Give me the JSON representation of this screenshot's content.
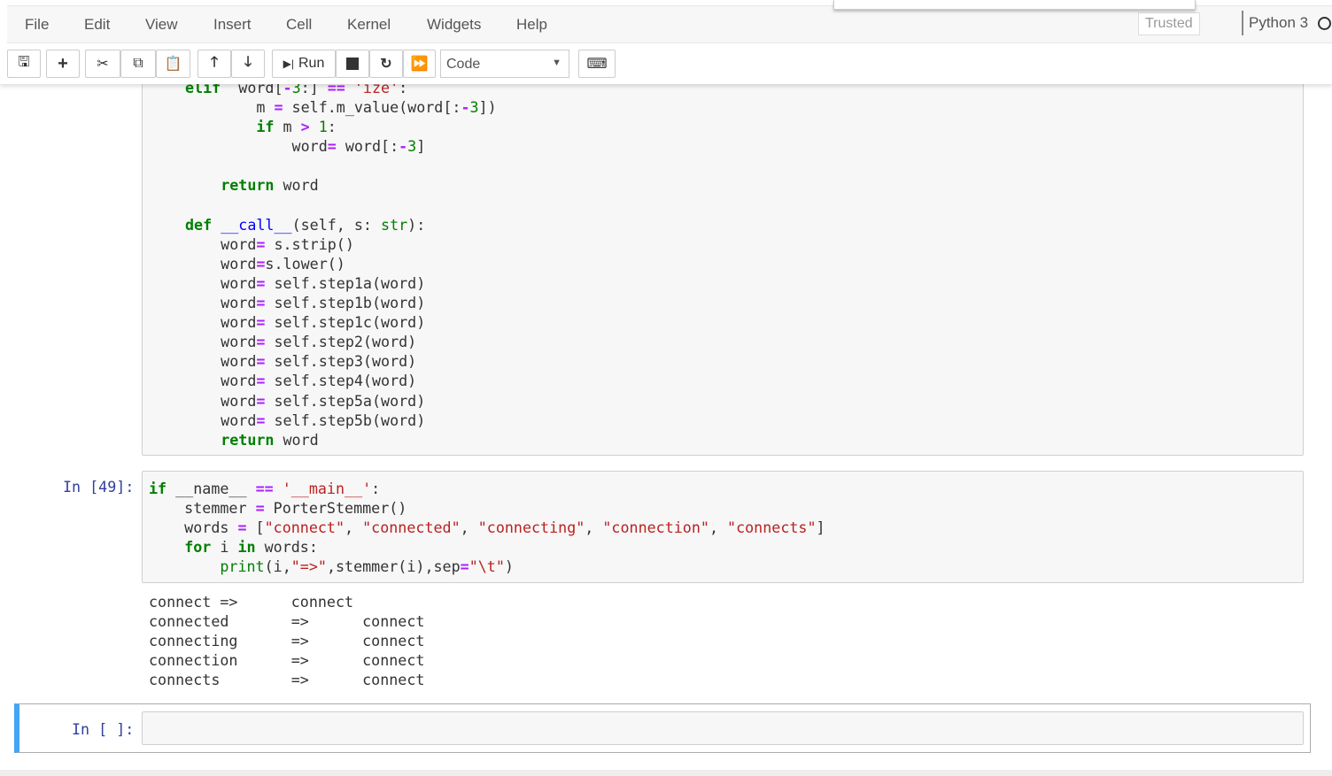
{
  "menu": [
    "File",
    "Edit",
    "View",
    "Insert",
    "Cell",
    "Kernel",
    "Widgets",
    "Help"
  ],
  "status": {
    "trusted": "Trusted",
    "kernel": "Python 3"
  },
  "toolbar": {
    "run_label": "Run",
    "cell_type": "Code"
  },
  "cells": [
    {
      "prompt": "",
      "lines": [
        [
          [
            "k",
            "elif"
          ],
          [
            "",
            "  word["
          ],
          [
            "o",
            "-"
          ],
          [
            "n",
            "3"
          ],
          [
            "",
            ":] "
          ],
          [
            "o",
            "=="
          ],
          [
            "",
            ""
          ],
          [
            "s",
            " 'ize'"
          ],
          [
            "",
            ":"
          ]
        ],
        [
          [
            "",
            "        m "
          ],
          [
            "o",
            "="
          ],
          [
            "",
            ""
          ],
          [
            "",
            " self.m_value(word[:"
          ],
          [
            "o",
            "-"
          ],
          [
            "n",
            "3"
          ],
          [
            "",
            "])"
          ]
        ],
        [
          [
            "",
            "        "
          ],
          [
            "k",
            "if"
          ],
          [
            "",
            " m "
          ],
          [
            "o",
            ">"
          ],
          [
            "",
            ""
          ],
          [
            "n",
            " 1"
          ],
          [
            "",
            ":"
          ]
        ],
        [
          [
            "",
            "            word"
          ],
          [
            "o",
            "="
          ],
          [
            "",
            " word[:"
          ],
          [
            "o",
            "-"
          ],
          [
            "n",
            "3"
          ],
          [
            "",
            "]"
          ]
        ],
        [],
        [
          [
            "",
            "    "
          ],
          [
            "k",
            "return"
          ],
          [
            "",
            " word"
          ]
        ],
        [],
        [
          [
            "k",
            "def"
          ],
          [
            "",
            " "
          ],
          [
            "f",
            "__call__"
          ],
          [
            "",
            "(self, s: "
          ],
          [
            "b",
            "str"
          ],
          [
            "",
            "):"
          ]
        ],
        [
          [
            "",
            "    word"
          ],
          [
            "o",
            "="
          ],
          [
            "",
            " s.strip()"
          ]
        ],
        [
          [
            "",
            "    word"
          ],
          [
            "o",
            "="
          ],
          [
            "",
            "s.lower()"
          ]
        ],
        [
          [
            "",
            "    word"
          ],
          [
            "o",
            "="
          ],
          [
            "",
            " self.step1a(word)"
          ]
        ],
        [
          [
            "",
            "    word"
          ],
          [
            "o",
            "="
          ],
          [
            "",
            " self.step1b(word)"
          ]
        ],
        [
          [
            "",
            "    word"
          ],
          [
            "o",
            "="
          ],
          [
            "",
            " self.step1c(word)"
          ]
        ],
        [
          [
            "",
            "    word"
          ],
          [
            "o",
            "="
          ],
          [
            "",
            " self.step2(word)"
          ]
        ],
        [
          [
            "",
            "    word"
          ],
          [
            "o",
            "="
          ],
          [
            "",
            " self.step3(word)"
          ]
        ],
        [
          [
            "",
            "    word"
          ],
          [
            "o",
            "="
          ],
          [
            "",
            " self.step4(word)"
          ]
        ],
        [
          [
            "",
            "    word"
          ],
          [
            "o",
            "="
          ],
          [
            "",
            " self.step5a(word)"
          ]
        ],
        [
          [
            "",
            "    word"
          ],
          [
            "o",
            "="
          ],
          [
            "",
            " self.step5b(word)"
          ]
        ],
        [
          [
            "",
            "    "
          ],
          [
            "k",
            "return"
          ],
          [
            "",
            " word"
          ]
        ]
      ]
    },
    {
      "prompt": "In [49]:",
      "lines": [
        [
          [
            "k",
            "if"
          ],
          [
            "",
            " __name__ "
          ],
          [
            "o",
            "=="
          ],
          [
            "",
            " "
          ],
          [
            "s",
            "'__main__'"
          ],
          [
            "",
            ":"
          ]
        ],
        [
          [
            "",
            "    stemmer "
          ],
          [
            "o",
            "="
          ],
          [
            "",
            " PorterStemmer()"
          ]
        ],
        [
          [
            "",
            "    words "
          ],
          [
            "o",
            "="
          ],
          [
            "",
            " ["
          ],
          [
            "s",
            "\"connect\""
          ],
          [
            "",
            ", "
          ],
          [
            "s",
            "\"connected\""
          ],
          [
            "",
            ", "
          ],
          [
            "s",
            "\"connecting\""
          ],
          [
            "",
            ", "
          ],
          [
            "s",
            "\"connection\""
          ],
          [
            "",
            ", "
          ],
          [
            "s",
            "\"connects\""
          ],
          [
            "",
            "]"
          ]
        ],
        [
          [
            "",
            "    "
          ],
          [
            "k",
            "for"
          ],
          [
            "",
            " i "
          ],
          [
            "k",
            "in"
          ],
          [
            "",
            " words:"
          ]
        ],
        [
          [
            "",
            "        "
          ],
          [
            "b",
            "print"
          ],
          [
            "",
            "(i,"
          ],
          [
            "s",
            "\"=>\""
          ],
          [
            "",
            ",stemmer(i),sep"
          ],
          [
            "o",
            "="
          ],
          [
            "s",
            "\"\\t\""
          ],
          [
            "",
            ")"
          ]
        ]
      ],
      "output": [
        "connect\t=>\tconnect",
        "connected\t=>\tconnect",
        "connecting\t=>\tconnect",
        "connection\t=>\tconnect",
        "connects\t=>\tconnect"
      ]
    },
    {
      "prompt": "In [ ]:",
      "lines": []
    }
  ]
}
